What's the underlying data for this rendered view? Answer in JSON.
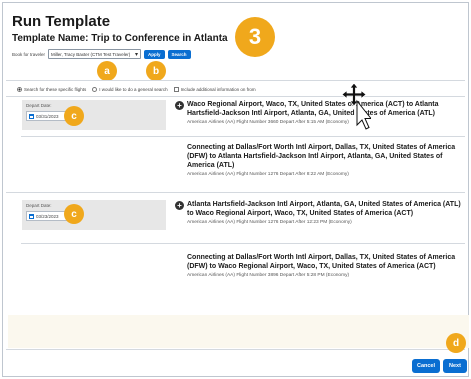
{
  "header": {
    "title": "Run Template",
    "template_name": "Template Name: Trip to Conference in Atlanta",
    "book_label": "Book for traveler",
    "traveler_value": "Miller, Tracy Baxter (CTM Test Traveler)",
    "apply_label": "Apply",
    "search_label": "Search"
  },
  "step_badges": {
    "main": "3",
    "a": "a",
    "b": "b",
    "c1": "c",
    "c2": "c",
    "d": "d"
  },
  "options": {
    "radio_specific": "Search for these specific flights",
    "radio_general": "I would like to do a general search",
    "include_info": "Include additional information on from"
  },
  "segments": [
    {
      "date_label": "Depart Date:",
      "date_value": "03/31/2023",
      "flights": [
        {
          "route": "Waco Regional Airport, Waco, TX, United States of America (ACT) to Atlanta Hartsfield-Jackson Intl Airport, Atlanta, GA, United States of America (ATL)",
          "meta": "American Airlines (AA)  Flight Number 3660  Depart After 5:15 AM    (Economy)"
        },
        {
          "route": "Connecting at Dallas/Fort Worth Intl Airport, Dallas, TX, United States of America (DFW) to Atlanta Hartsfield-Jackson Intl Airport, Atlanta, GA, United States of America (ATL)",
          "meta": "American Airlines (AA)  Flight Number 1276  Depart After 8:22 AM    (Economy)"
        }
      ]
    },
    {
      "date_label": "Depart Date:",
      "date_value": "03/23/2023",
      "flights": [
        {
          "route": "Atlanta Hartsfield-Jackson Intl Airport, Atlanta, GA, United States of America (ATL) to Waco Regional Airport, Waco, TX, United States of America (ACT)",
          "meta": "American Airlines (AA)  Flight Number 1276  Depart After 12:23 PM    (Economy)"
        },
        {
          "route": "Connecting at Dallas/Fort Worth Intl Airport, Dallas, TX, United States of America (DFW) to Waco Regional Airport, Waco, TX, United States of America (ACT)",
          "meta": "American Airlines (AA)  Flight Number 3896  Depart After 5:28 PM    (Economy)"
        }
      ]
    }
  ],
  "footer": {
    "cancel_label": "Cancel",
    "next_label": "Next"
  },
  "colors": {
    "accent": "#0a6ed1",
    "badge": "#f0a81c",
    "panel": "#e7e7e7"
  },
  "icons": [
    "calendar-icon",
    "plus-circle-icon",
    "chevron-down-icon",
    "move-cursor-icon"
  ]
}
